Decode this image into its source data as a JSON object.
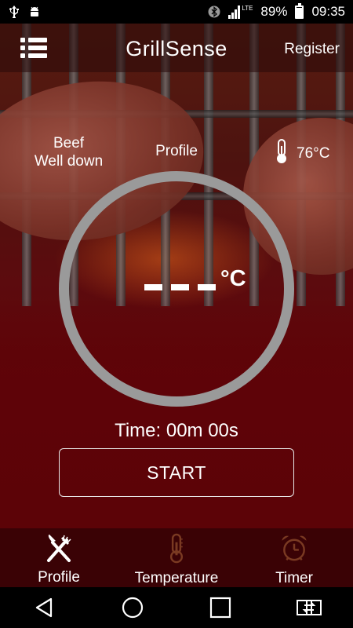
{
  "status_bar": {
    "battery": "89%",
    "time": "09:35",
    "network": "LTE"
  },
  "header": {
    "title": "GrillSense",
    "register_label": "Register",
    "menu_icon": "list-menu-icon"
  },
  "info": {
    "meat_type": "Beef",
    "doneness": "Well down",
    "profile_label": "Profile",
    "ambient_temp": "76°C"
  },
  "gauge": {
    "unit": "°C"
  },
  "timer": {
    "time_text": "Time: 00m 00s"
  },
  "actions": {
    "start_label": "START"
  },
  "tabs": [
    {
      "label": "Profile",
      "icon": "fork-knife-icon",
      "active": true
    },
    {
      "label": "Temperature",
      "icon": "thermometer-icon",
      "active": false
    },
    {
      "label": "Timer",
      "icon": "alarm-clock-icon",
      "active": false
    }
  ],
  "colors": {
    "background": "#5c0307",
    "tab_bar": "#3a0205",
    "gauge_ring": "#9a9a9a",
    "inactive_icon": "#7a3a22"
  }
}
